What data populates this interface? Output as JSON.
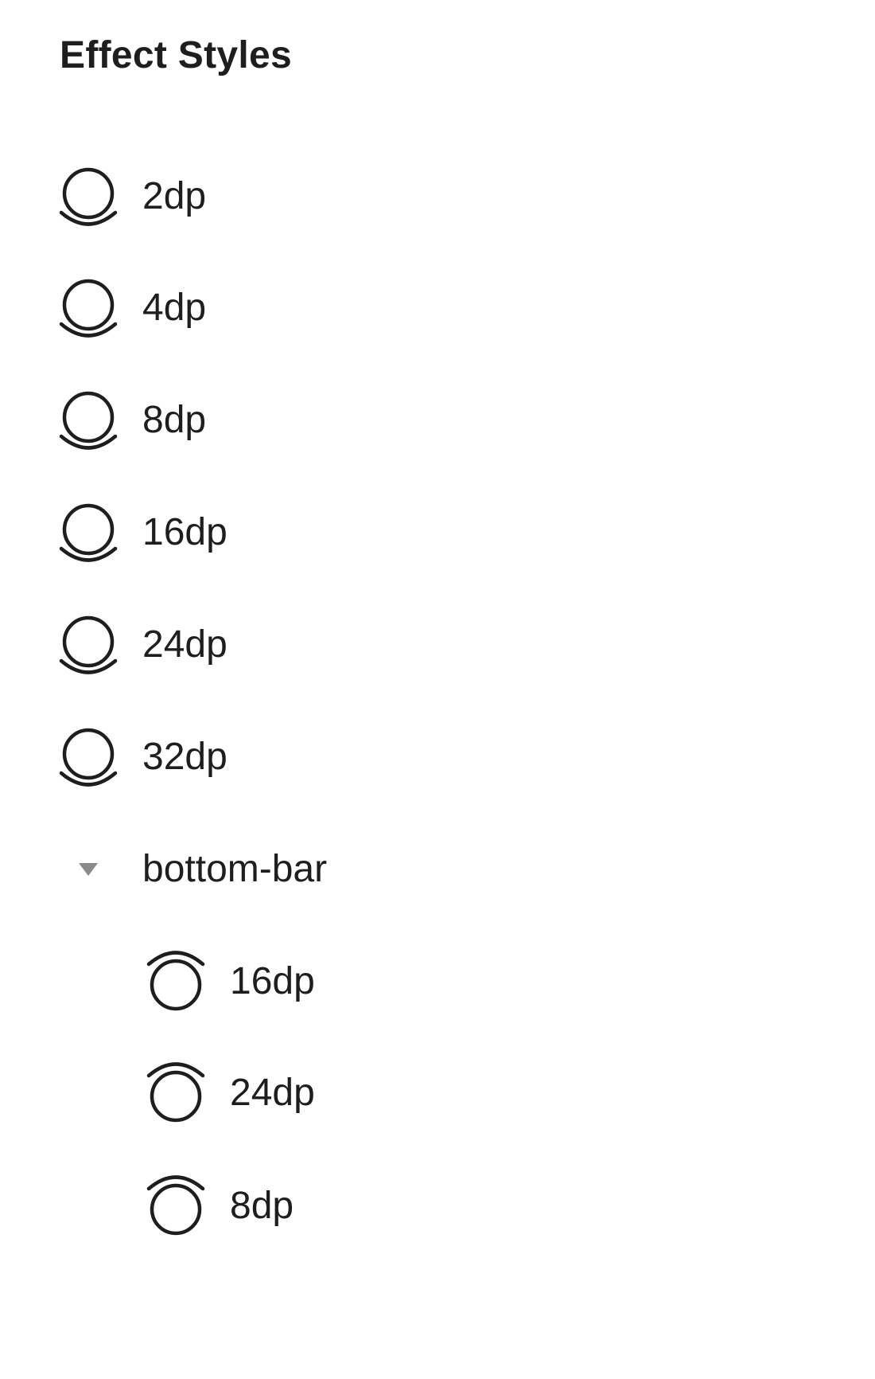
{
  "panel": {
    "title": "Effect Styles"
  },
  "styles": [
    {
      "label": "2dp",
      "icon": "drop-shadow-icon"
    },
    {
      "label": "4dp",
      "icon": "drop-shadow-icon"
    },
    {
      "label": "8dp",
      "icon": "drop-shadow-icon"
    },
    {
      "label": "16dp",
      "icon": "drop-shadow-icon"
    },
    {
      "label": "24dp",
      "icon": "drop-shadow-icon"
    },
    {
      "label": "32dp",
      "icon": "drop-shadow-icon"
    }
  ],
  "folder": {
    "label": "bottom-bar",
    "icon": "caret-down-icon",
    "items": [
      {
        "label": "16dp",
        "icon": "top-shadow-icon"
      },
      {
        "label": "24dp",
        "icon": "top-shadow-icon"
      },
      {
        "label": "8dp",
        "icon": "top-shadow-icon"
      }
    ]
  },
  "colors": {
    "text": "#1e1e1e",
    "icon_stroke": "#1e1e1e",
    "caret": "#8a8a8a",
    "background": "#ffffff"
  }
}
